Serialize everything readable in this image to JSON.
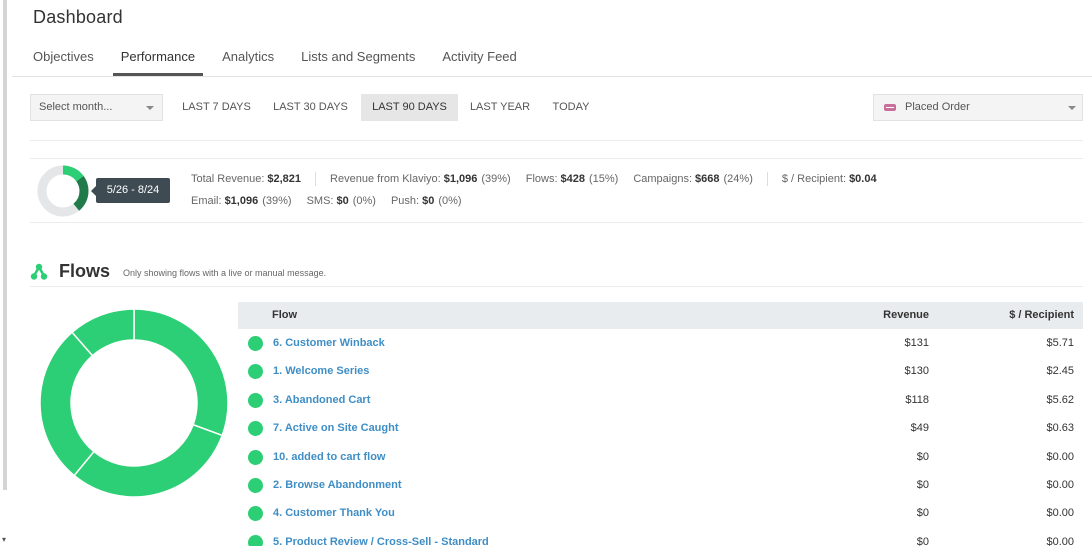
{
  "page": {
    "title": "Dashboard"
  },
  "tabs": [
    {
      "label": "Objectives",
      "active": false
    },
    {
      "label": "Performance",
      "active": true
    },
    {
      "label": "Analytics",
      "active": false
    },
    {
      "label": "Lists and Segments",
      "active": false
    },
    {
      "label": "Activity Feed",
      "active": false
    }
  ],
  "filters": {
    "month_select": "Select month...",
    "ranges": [
      {
        "label": "LAST 7 DAYS",
        "active": false
      },
      {
        "label": "LAST 30 DAYS",
        "active": false
      },
      {
        "label": "LAST 90 DAYS",
        "active": true
      },
      {
        "label": "LAST YEAR",
        "active": false
      },
      {
        "label": "TODAY",
        "active": false
      }
    ],
    "metric_select": "Placed Order",
    "metric_icon": "email-icon"
  },
  "summary": {
    "date_range": "5/26 - 8/24",
    "total_revenue": {
      "label": "Total Revenue:",
      "value": "$2,821"
    },
    "klaviyo_revenue": {
      "label": "Revenue from Klaviyo:",
      "value": "$1,096",
      "pct": "(39%)"
    },
    "flows": {
      "label": "Flows:",
      "value": "$428",
      "pct": "(15%)"
    },
    "campaigns": {
      "label": "Campaigns:",
      "value": "$668",
      "pct": "(24%)"
    },
    "per_recipient": {
      "label": "$ / Recipient:",
      "value": "$0.04"
    },
    "email": {
      "label": "Email:",
      "value": "$1,096",
      "pct": "(39%)"
    },
    "sms": {
      "label": "SMS:",
      "value": "$0",
      "pct": "(0%)"
    },
    "push": {
      "label": "Push:",
      "value": "$0",
      "pct": "(0%)"
    },
    "donut_share": 0.39,
    "donut_split": [
      0.15,
      0.24
    ],
    "colors": {
      "dark": "#217a4a",
      "light": "#2ccf75",
      "track": "#e4e6e8"
    }
  },
  "flows_section": {
    "title": "Flows",
    "note": "Only showing flows with a live or manual message.",
    "icon": "flows-icon",
    "accent": "#2ccf75",
    "table": {
      "headers": {
        "flow": "Flow",
        "revenue": "Revenue",
        "per_recipient": "$ / Recipient"
      },
      "rows": [
        {
          "flow": "6. Customer Winback",
          "revenue": "$131",
          "per_recipient": "$5.71"
        },
        {
          "flow": "1. Welcome Series",
          "revenue": "$130",
          "per_recipient": "$2.45"
        },
        {
          "flow": "3. Abandoned Cart",
          "revenue": "$118",
          "per_recipient": "$5.62"
        },
        {
          "flow": "7. Active on Site Caught",
          "revenue": "$49",
          "per_recipient": "$0.63"
        },
        {
          "flow": "10. added to cart flow",
          "revenue": "$0",
          "per_recipient": "$0.00"
        },
        {
          "flow": "2. Browse Abandonment",
          "revenue": "$0",
          "per_recipient": "$0.00"
        },
        {
          "flow": "4. Customer Thank You",
          "revenue": "$0",
          "per_recipient": "$0.00"
        },
        {
          "flow": "5. Product Review / Cross-Sell - Standard",
          "revenue": "$0",
          "per_recipient": "$0.00"
        }
      ]
    },
    "donut_values": [
      131,
      130,
      118,
      49
    ]
  }
}
